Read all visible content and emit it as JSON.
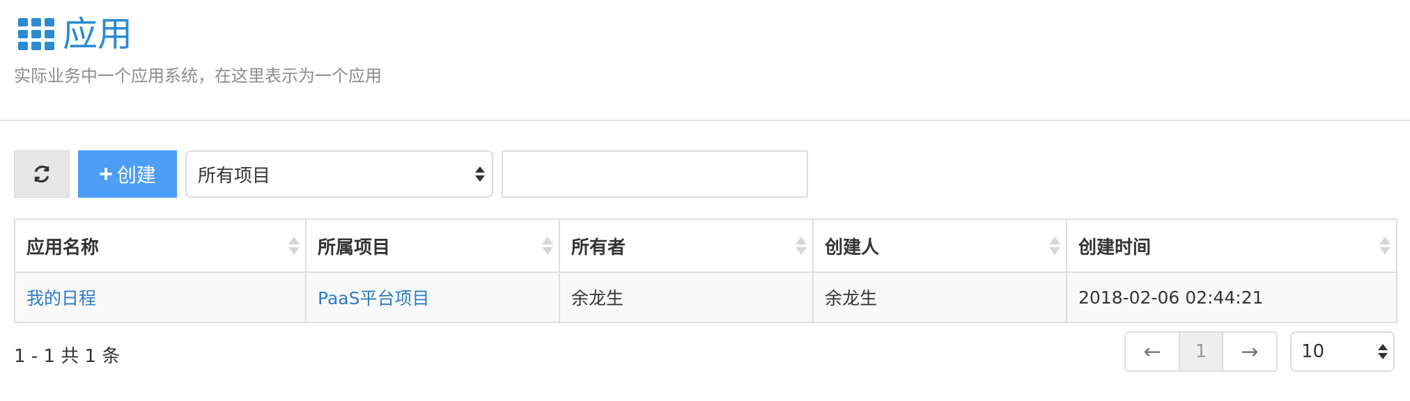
{
  "header": {
    "title": "应用",
    "subtitle": "实际业务中一个应用系统，在这里表示为一个应用",
    "accent_color": "#2a8bd0"
  },
  "toolbar": {
    "refresh_icon": "refresh-icon",
    "create_label": "创建",
    "create_icon": "plus-icon",
    "project_filter": "所有项目",
    "search_placeholder": "",
    "primary_color": "#4d9ef7"
  },
  "table": {
    "columns": [
      "应用名称",
      "所属项目",
      "所有者",
      "创建人",
      "创建时间"
    ],
    "rows": [
      [
        "我的日程",
        "PaaS平台项目",
        "余龙生",
        "余龙生",
        "2018-02-06 02:44:21"
      ]
    ],
    "link_color": "#2a7cc7"
  },
  "pagination": {
    "summary": "1 - 1 共 1 条",
    "prev": "←",
    "current_page": "1",
    "next": "→",
    "page_size": "10"
  }
}
